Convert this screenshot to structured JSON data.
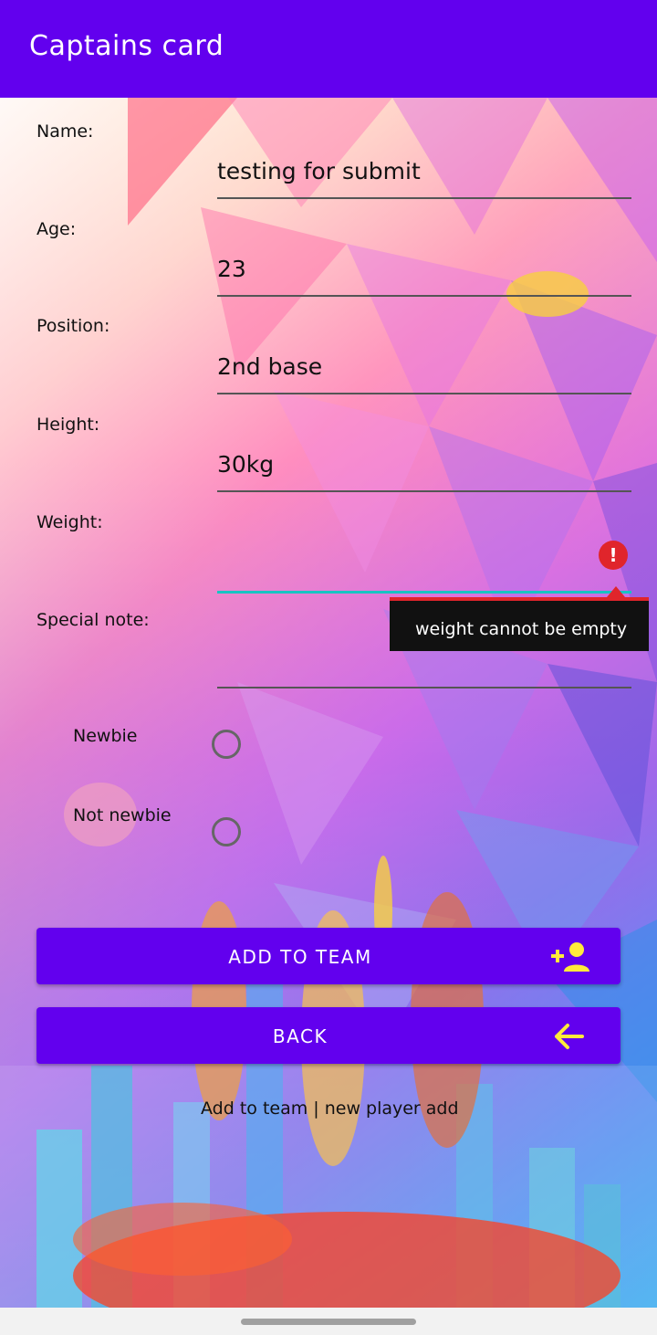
{
  "app_bar": {
    "title": "Captains card"
  },
  "form": {
    "name": {
      "label": "Name:",
      "value": "testing for submit"
    },
    "age": {
      "label": "Age:",
      "value": "23"
    },
    "position": {
      "label": "Position:",
      "value": "2nd base"
    },
    "height": {
      "label": "Height:",
      "value": "30kg"
    },
    "weight": {
      "label": "Weight:",
      "value": "",
      "error": "weight cannot be empty"
    },
    "special_note": {
      "label": "Special note:",
      "value": ""
    }
  },
  "radios": {
    "newbie": {
      "label": "Newbie",
      "checked": false
    },
    "not_newbie": {
      "label": "Not newbie",
      "checked": false
    }
  },
  "buttons": {
    "add": {
      "label": "ADD TO TEAM",
      "icon": "add-person-icon"
    },
    "back": {
      "label": "BACK",
      "icon": "arrow-left-icon"
    }
  },
  "footer": {
    "text": "Add to team | new player add"
  },
  "colors": {
    "primary": "#6200ee",
    "accent_icon": "#ffeb3b",
    "error": "#e0252b",
    "focus": "#18c3c3"
  }
}
